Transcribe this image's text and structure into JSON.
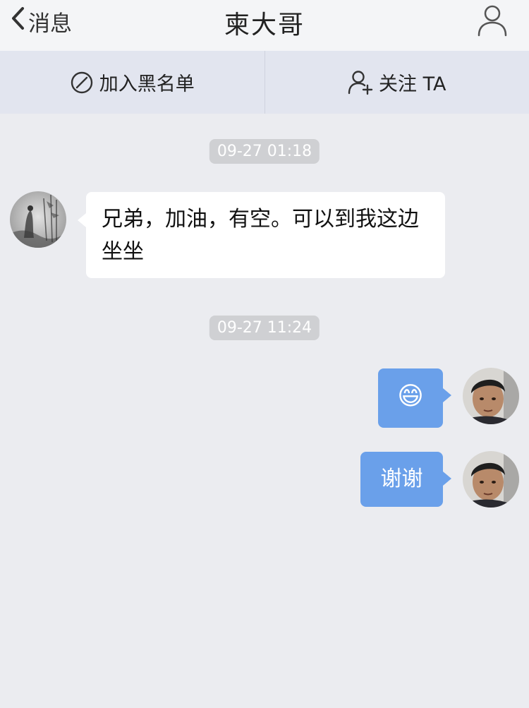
{
  "nav": {
    "back_label": "消息",
    "title": "柬大哥",
    "back_icon": "chevron-left-icon",
    "profile_icon": "person-icon"
  },
  "actions": {
    "blacklist_label": "加入黑名单",
    "blacklist_icon": "block-icon",
    "follow_label": "关注 TA",
    "follow_icon": "add-person-icon"
  },
  "messages": [
    {
      "type": "timestamp",
      "text": "09-27 01:18"
    },
    {
      "type": "incoming",
      "text": "兄弟，加油，有空。可以到我这边坐坐",
      "avatar": "ink-painting-avatar"
    },
    {
      "type": "timestamp",
      "text": "09-27 11:24"
    },
    {
      "type": "outgoing",
      "text": "😄",
      "avatar": "user-photo-avatar"
    },
    {
      "type": "outgoing",
      "text": "谢谢",
      "avatar": "user-photo-avatar"
    }
  ],
  "colors": {
    "background": "#ebecf0",
    "navbar": "#f4f5f7",
    "actionbar": "#e2e5ef",
    "outgoing_bubble": "#6aa0ea",
    "incoming_bubble": "#ffffff",
    "timestamp_bg": "#cfd0d3"
  }
}
